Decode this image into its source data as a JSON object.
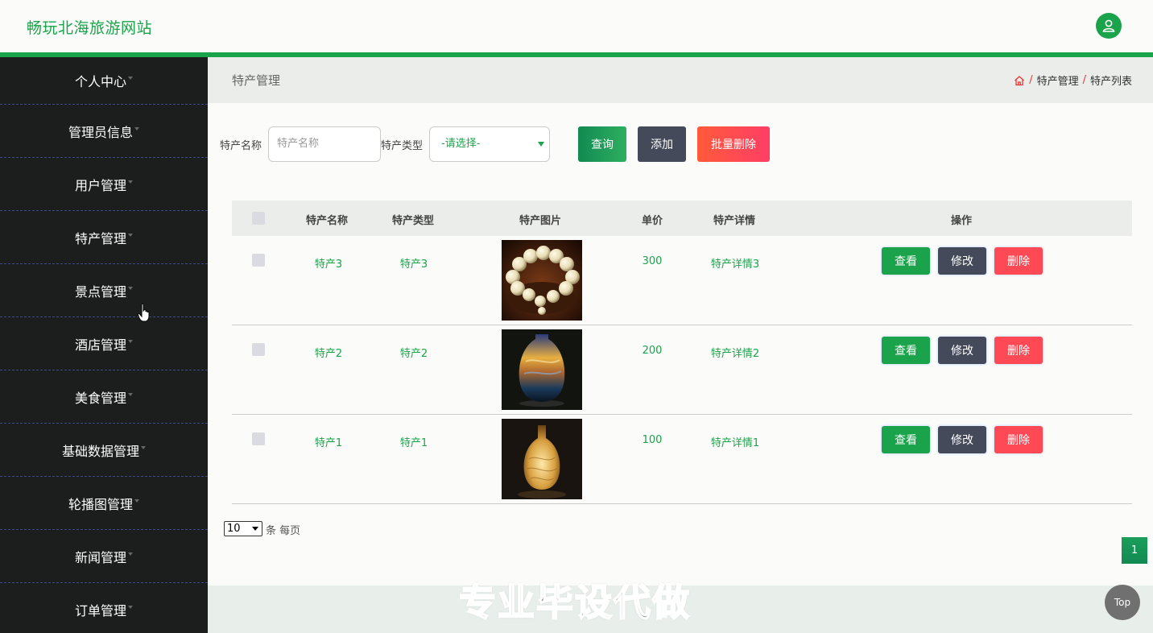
{
  "header": {
    "brand": "畅玩北海旅游网站",
    "avatar_icon": "user-icon",
    "accent": "#1aa34a"
  },
  "sidebar": {
    "items": [
      {
        "label": "个人中心"
      },
      {
        "label": "管理员信息"
      },
      {
        "label": "用户管理"
      },
      {
        "label": "特产管理"
      },
      {
        "label": "景点管理"
      },
      {
        "label": "酒店管理"
      },
      {
        "label": "美食管理"
      },
      {
        "label": "基础数据管理"
      },
      {
        "label": "轮播图管理"
      },
      {
        "label": "新闻管理"
      },
      {
        "label": "订单管理"
      }
    ]
  },
  "breadcrumb": {
    "title": "特产管理",
    "home_icon": "home-icon",
    "sep": "/",
    "level1": "特产管理",
    "level2": "特产列表"
  },
  "search": {
    "name_label": "特产名称",
    "name_placeholder": "特产名称",
    "type_label": "特产类型",
    "type_value": "-请选择-",
    "query_label": "查询",
    "add_label": "添加",
    "batch_delete_label": "批量删除"
  },
  "table": {
    "headers": {
      "name": "特产名称",
      "type": "特产类型",
      "image": "特产图片",
      "price": "单价",
      "detail": "特产详情",
      "ops": "操作"
    },
    "rows": [
      {
        "name": "特产3",
        "type": "特产3",
        "price": "300",
        "detail": "特产详情3",
        "image": "bracelet"
      },
      {
        "name": "特产2",
        "type": "特产2",
        "price": "200",
        "detail": "特产详情2",
        "image": "vase"
      },
      {
        "name": "特产1",
        "type": "特产1",
        "price": "100",
        "detail": "特产详情1",
        "image": "lamp"
      }
    ],
    "view_label": "查看",
    "edit_label": "修改",
    "delete_label": "删除"
  },
  "pagination": {
    "page_size": "10",
    "page_size_suffix": "条 每页",
    "current_page": "1"
  },
  "watermark": "专业毕设代做",
  "top_label": "Top"
}
